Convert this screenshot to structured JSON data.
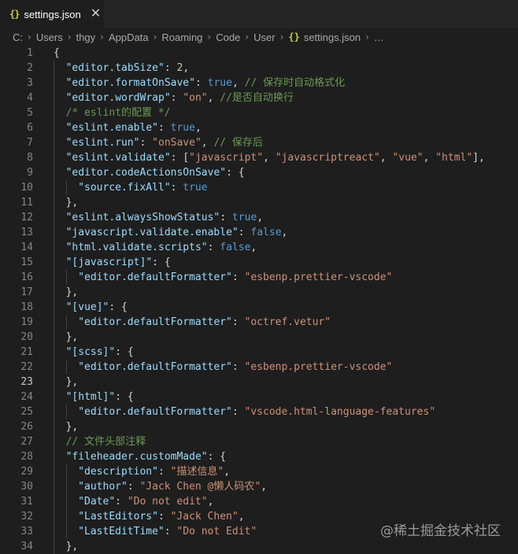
{
  "tab": {
    "icon": "{}",
    "label": "settings.json",
    "close": "✕"
  },
  "breadcrumb": [
    "C:",
    "Users",
    "thgy",
    "AppData",
    "Roaming",
    "Code",
    "User",
    "settings.json",
    "…"
  ],
  "breadcrumb_icon": "{}",
  "watermark": "@稀土掘金技术社区",
  "active_line": 23,
  "lines": [
    {
      "n": "1",
      "indent": 0,
      "tokens": [
        [
          "p",
          "{"
        ]
      ]
    },
    {
      "n": "2",
      "indent": 1,
      "tokens": [
        [
          "k",
          "\"editor.tabSize\""
        ],
        [
          "p",
          ": "
        ],
        [
          "n",
          "2"
        ],
        [
          "p",
          ","
        ]
      ]
    },
    {
      "n": "3",
      "indent": 1,
      "tokens": [
        [
          "k",
          "\"editor.formatOnSave\""
        ],
        [
          "p",
          ": "
        ],
        [
          "b",
          "true"
        ],
        [
          "p",
          ", "
        ],
        [
          "c",
          "// 保存时自动格式化"
        ]
      ]
    },
    {
      "n": "4",
      "indent": 1,
      "tokens": [
        [
          "k",
          "\"editor.wordWrap\""
        ],
        [
          "p",
          ": "
        ],
        [
          "s",
          "\"on\""
        ],
        [
          "p",
          ", "
        ],
        [
          "c",
          "//是否自动换行"
        ]
      ]
    },
    {
      "n": "5",
      "indent": 1,
      "tokens": [
        [
          "c",
          "/* eslint的配置 */"
        ]
      ]
    },
    {
      "n": "6",
      "indent": 1,
      "tokens": [
        [
          "k",
          "\"eslint.enable\""
        ],
        [
          "p",
          ": "
        ],
        [
          "b",
          "true"
        ],
        [
          "p",
          ","
        ]
      ]
    },
    {
      "n": "7",
      "indent": 1,
      "tokens": [
        [
          "k",
          "\"eslint.run\""
        ],
        [
          "p",
          ": "
        ],
        [
          "s",
          "\"onSave\""
        ],
        [
          "p",
          ", "
        ],
        [
          "c",
          "// 保存后"
        ]
      ]
    },
    {
      "n": "8",
      "indent": 1,
      "tokens": [
        [
          "k",
          "\"eslint.validate\""
        ],
        [
          "p",
          ": ["
        ],
        [
          "s",
          "\"javascript\""
        ],
        [
          "p",
          ", "
        ],
        [
          "s",
          "\"javascriptreact\""
        ],
        [
          "p",
          ", "
        ],
        [
          "s",
          "\"vue\""
        ],
        [
          "p",
          ", "
        ],
        [
          "s",
          "\"html\""
        ],
        [
          "p",
          "],"
        ]
      ]
    },
    {
      "n": "9",
      "indent": 1,
      "tokens": [
        [
          "k",
          "\"editor.codeActionsOnSave\""
        ],
        [
          "p",
          ": {"
        ]
      ]
    },
    {
      "n": "10",
      "indent": 2,
      "tokens": [
        [
          "k",
          "\"source.fixAll\""
        ],
        [
          "p",
          ": "
        ],
        [
          "b",
          "true"
        ]
      ]
    },
    {
      "n": "11",
      "indent": 1,
      "tokens": [
        [
          "p",
          "},"
        ]
      ]
    },
    {
      "n": "12",
      "indent": 1,
      "tokens": [
        [
          "k",
          "\"eslint.alwaysShowStatus\""
        ],
        [
          "p",
          ": "
        ],
        [
          "b",
          "true"
        ],
        [
          "p",
          ","
        ]
      ]
    },
    {
      "n": "13",
      "indent": 1,
      "tokens": [
        [
          "k",
          "\"javascript.validate.enable\""
        ],
        [
          "p",
          ": "
        ],
        [
          "b",
          "false"
        ],
        [
          "p",
          ","
        ]
      ]
    },
    {
      "n": "14",
      "indent": 1,
      "tokens": [
        [
          "k",
          "\"html.validate.scripts\""
        ],
        [
          "p",
          ": "
        ],
        [
          "b",
          "false"
        ],
        [
          "p",
          ","
        ]
      ]
    },
    {
      "n": "15",
      "indent": 1,
      "tokens": [
        [
          "k",
          "\"[javascript]\""
        ],
        [
          "p",
          ": {"
        ]
      ]
    },
    {
      "n": "16",
      "indent": 2,
      "tokens": [
        [
          "k",
          "\"editor.defaultFormatter\""
        ],
        [
          "p",
          ": "
        ],
        [
          "s",
          "\"esbenp.prettier-vscode\""
        ]
      ]
    },
    {
      "n": "17",
      "indent": 1,
      "tokens": [
        [
          "p",
          "},"
        ]
      ]
    },
    {
      "n": "18",
      "indent": 1,
      "tokens": [
        [
          "k",
          "\"[vue]\""
        ],
        [
          "p",
          ": {"
        ]
      ]
    },
    {
      "n": "19",
      "indent": 2,
      "tokens": [
        [
          "k",
          "\"editor.defaultFormatter\""
        ],
        [
          "p",
          ": "
        ],
        [
          "s",
          "\"octref.vetur\""
        ]
      ]
    },
    {
      "n": "20",
      "indent": 1,
      "tokens": [
        [
          "p",
          "},"
        ]
      ]
    },
    {
      "n": "21",
      "indent": 1,
      "tokens": [
        [
          "k",
          "\"[scss]\""
        ],
        [
          "p",
          ": {"
        ]
      ]
    },
    {
      "n": "22",
      "indent": 2,
      "tokens": [
        [
          "k",
          "\"editor.defaultFormatter\""
        ],
        [
          "p",
          ": "
        ],
        [
          "s",
          "\"esbenp.prettier-vscode\""
        ]
      ]
    },
    {
      "n": "23",
      "indent": 1,
      "tokens": [
        [
          "p",
          "},"
        ]
      ]
    },
    {
      "n": "24",
      "indent": 1,
      "tokens": [
        [
          "k",
          "\"[html]\""
        ],
        [
          "p",
          ": {"
        ]
      ]
    },
    {
      "n": "25",
      "indent": 2,
      "tokens": [
        [
          "k",
          "\"editor.defaultFormatter\""
        ],
        [
          "p",
          ": "
        ],
        [
          "s",
          "\"vscode.html-language-features\""
        ]
      ]
    },
    {
      "n": "26",
      "indent": 1,
      "tokens": [
        [
          "p",
          "},"
        ]
      ]
    },
    {
      "n": "27",
      "indent": 1,
      "tokens": [
        [
          "c",
          "// 文件头部注释"
        ]
      ]
    },
    {
      "n": "28",
      "indent": 1,
      "tokens": [
        [
          "k",
          "\"fileheader.customMade\""
        ],
        [
          "p",
          ": {"
        ]
      ]
    },
    {
      "n": "29",
      "indent": 2,
      "tokens": [
        [
          "k",
          "\"description\""
        ],
        [
          "p",
          ": "
        ],
        [
          "s",
          "\"描述信息\""
        ],
        [
          "p",
          ","
        ]
      ]
    },
    {
      "n": "30",
      "indent": 2,
      "tokens": [
        [
          "k",
          "\"author\""
        ],
        [
          "p",
          ": "
        ],
        [
          "s",
          "\"Jack Chen @懒人码农\""
        ],
        [
          "p",
          ","
        ]
      ]
    },
    {
      "n": "31",
      "indent": 2,
      "tokens": [
        [
          "k",
          "\"Date\""
        ],
        [
          "p",
          ": "
        ],
        [
          "s",
          "\"Do not edit\""
        ],
        [
          "p",
          ","
        ]
      ]
    },
    {
      "n": "32",
      "indent": 2,
      "tokens": [
        [
          "k",
          "\"LastEditors\""
        ],
        [
          "p",
          ": "
        ],
        [
          "s",
          "\"Jack Chen\""
        ],
        [
          "p",
          ","
        ]
      ]
    },
    {
      "n": "33",
      "indent": 2,
      "tokens": [
        [
          "k",
          "\"LastEditTime\""
        ],
        [
          "p",
          ": "
        ],
        [
          "s",
          "\"Do not Edit\""
        ]
      ]
    },
    {
      "n": "34",
      "indent": 1,
      "tokens": [
        [
          "p",
          "},"
        ]
      ]
    }
  ]
}
